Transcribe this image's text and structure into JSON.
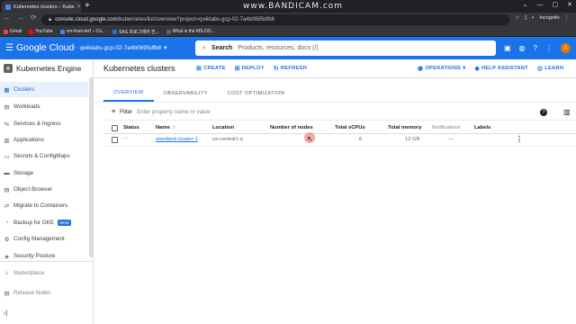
{
  "browser": {
    "tab_title": "Kubernetes clusters – Kubernete",
    "tab_close": "×",
    "new_tab": "+",
    "watermark_main": "www.BANDICAM",
    "watermark_suffix": ".com",
    "window_controls": [
      "⌄",
      "—",
      "▢",
      "✕"
    ],
    "url_host": "console.cloud.google.com",
    "url_path": "/kubernetes/list/overview?project=qwiklabs-gcp-02-7a4b0695dfb8",
    "incognito_label": "Incognito",
    "nav": [
      "←",
      "→",
      "⟳"
    ],
    "bookmarks": [
      {
        "label": "Gmail",
        "color": "#ea4335"
      },
      {
        "label": "YouTube",
        "color": "#ff0000"
      },
      {
        "label": "vm-from-terf – Co...",
        "color": "#4285f4"
      },
      {
        "label": "SAS 프로그래머 전...",
        "color": "#1a73e8"
      },
      {
        "label": "What is the MS-DO...",
        "color": "#5f6368"
      }
    ]
  },
  "header": {
    "brand": "Google Cloud",
    "project": "qwiklabs-gcp-02-7a4b0695dfb8",
    "search_label": "Search",
    "search_placeholder": "Products, resources, docs (/)",
    "avatar_letter": "A"
  },
  "sidebar": {
    "title": "Kubernetes Engine",
    "items": [
      {
        "label": "Clusters",
        "icon": "clusters-icon",
        "glyph": "▦",
        "active": true
      },
      {
        "label": "Workloads",
        "icon": "workloads-icon",
        "glyph": "▤"
      },
      {
        "label": "Services & Ingress",
        "icon": "services-icon",
        "glyph": "⇆"
      },
      {
        "label": "Applications",
        "icon": "applications-icon",
        "glyph": "▥"
      },
      {
        "label": "Secrets & ConfigMaps",
        "icon": "secrets-icon",
        "glyph": "▭"
      },
      {
        "label": "Storage",
        "icon": "storage-icon",
        "glyph": "▬"
      },
      {
        "label": "Object Browser",
        "icon": "object-browser-icon",
        "glyph": "▤"
      },
      {
        "label": "Migrate to Containers",
        "icon": "migrate-icon",
        "glyph": "⇄"
      },
      {
        "label": "Backup for GKE",
        "icon": "backup-icon",
        "glyph": "◔",
        "badge": "NEW"
      },
      {
        "label": "Config Management",
        "icon": "config-icon",
        "glyph": "⚙"
      },
      {
        "label": "Security Posture",
        "icon": "security-icon",
        "glyph": "◈"
      },
      {
        "label": "Marketplace",
        "icon": "marketplace-icon",
        "glyph": "⌂"
      },
      {
        "label": "Release Notes",
        "icon": "release-notes-icon",
        "glyph": "▤"
      }
    ],
    "collapse": "‹|"
  },
  "main": {
    "title": "Kubernetes clusters",
    "actions": [
      {
        "label": "CREATE",
        "glyph": "⊞"
      },
      {
        "label": "DEPLOY",
        "glyph": "⊞"
      },
      {
        "label": "REFRESH",
        "glyph": "↻"
      }
    ],
    "right_actions": [
      {
        "label": "OPERATIONS",
        "glyph": "◉",
        "suffix": "▾"
      },
      {
        "label": "HELP ASSISTANT",
        "glyph": "◆"
      },
      {
        "label": "LEARN",
        "glyph": "◎"
      }
    ],
    "tabs": [
      "OVERVIEW",
      "OBSERVABILITY",
      "COST OPTIMIZATION"
    ],
    "filter_label": "Filter",
    "filter_placeholder": "Enter property name or value",
    "table": {
      "headers": [
        "Status",
        "Name",
        "Location",
        "Number of nodes",
        "Total vCPUs",
        "Total memory",
        "Notifications",
        "Labels"
      ],
      "sort_arrow": "↑",
      "rows": [
        {
          "status": "◠",
          "name": "standard-cluster-1",
          "location": "us-central1-a",
          "nodes": "3",
          "vcpus": "6",
          "memory": "12 GB",
          "notifications": "—",
          "labels": ""
        }
      ]
    }
  }
}
